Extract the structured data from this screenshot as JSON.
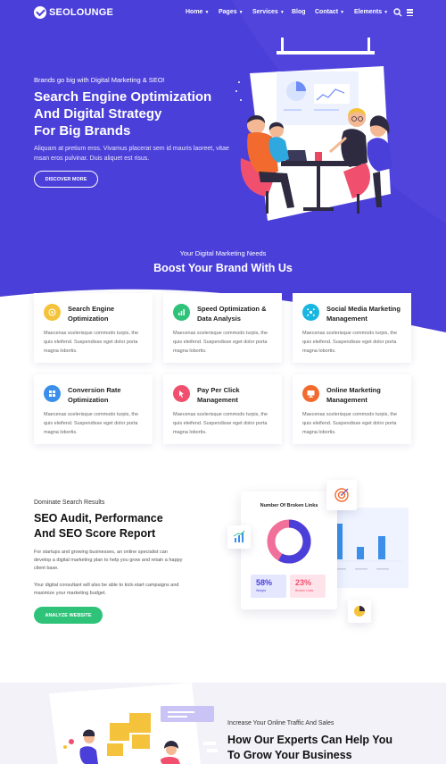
{
  "nav": {
    "logo_text": "SEOLOUNGE",
    "items": [
      {
        "label": "Home",
        "caret": true
      },
      {
        "label": "Pages",
        "caret": true
      },
      {
        "label": "Services",
        "caret": true
      },
      {
        "label": "Blog",
        "caret": false
      },
      {
        "label": "Contact",
        "caret": true
      },
      {
        "label": "Elements",
        "caret": true
      }
    ],
    "icons": [
      "search-icon",
      "menu-icon"
    ]
  },
  "hero": {
    "eyebrow": "Brands go big with Digital Marketing & SEO!",
    "title_lines": [
      "Search Engine Optimization",
      "And Digital Strategy",
      "For Big Brands"
    ],
    "subtitle": "Aliquam at pretium eros. Vivamus placerat sem id mauris laoreet, vitae msan eros pulvinar. Duis aliquet est risus.",
    "button": "DISCOVER MORE"
  },
  "services": {
    "eyebrow": "Your Digital Marketing Needs",
    "title": "Boost Your Brand With Us",
    "cards": [
      {
        "title": "Search Engine Optimization",
        "text": "Maecenas scelerisque commodo turpis, the quis eleifend. Suspendisse eget dolor porta magna lobortis.",
        "icon": "target-icon",
        "color": "#f5c33b"
      },
      {
        "title": "Speed Optimization & Data Analysis",
        "text": "Maecenas scelerisque commodo turpis, the quis eleifend. Suspendisse eget dolor porta magna lobortis.",
        "icon": "bar-chart-icon",
        "color": "#2fc37a"
      },
      {
        "title": "Social Media Marketing Management",
        "text": "Maecenas scelerisque commodo turpis, the quis eleifend. Suspendisse eget dolor porta magna lobortis.",
        "icon": "network-icon",
        "color": "#18b6e0"
      },
      {
        "title": "Conversion Rate Optimization",
        "text": "Maecenas scelerisque commodo turpis, the quis eleifend. Suspendisse eget dolor porta magna lobortis.",
        "icon": "grid-icon",
        "color": "#3b8eea"
      },
      {
        "title": "Pay Per Click Management",
        "text": "Maecenas scelerisque commodo turpis, the quis eleifend. Suspendisse eget dolor porta magna lobortis.",
        "icon": "cursor-click-icon",
        "color": "#f0506e"
      },
      {
        "title": "Online Marketing Management",
        "text": "Maecenas scelerisque commodo turpis, the quis eleifend. Suspendisse eget dolor porta magna lobortis.",
        "icon": "monitor-icon",
        "color": "#f26a2e"
      }
    ]
  },
  "audit": {
    "eyebrow": "Dominate Search Results",
    "title_lines": [
      "SEO Audit, Performance",
      "And SEO Score Report"
    ],
    "p1": "For startups and growing businesses, an online specialist can develop a digital marketing plan to help you grow and retain a happy client base.",
    "p2": "Your digital consultant will also be able to kick-start campaigns and maximize your marketing budget.",
    "button": "ANALYZE WEBSITE",
    "dashboard": {
      "title": "Number Of Broken Links",
      "donut_fraction": 0.58,
      "stat1": {
        "value": "58%",
        "label": "Weight"
      },
      "stat2": {
        "value": "23%",
        "label": "Broken Links"
      }
    }
  },
  "bottom": {
    "eyebrow": "Increase Your Online Traffic And Sales",
    "title_lines": [
      "How Our Experts Can Help You",
      "To Grow Your Business"
    ]
  },
  "colors": {
    "brand": "#4b3fd9",
    "green": "#2fc37a"
  }
}
